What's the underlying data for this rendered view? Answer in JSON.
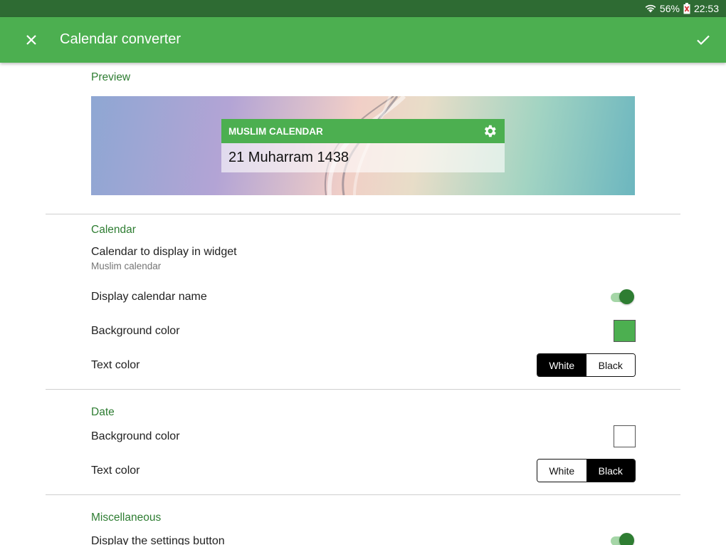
{
  "status_bar": {
    "battery": "56%",
    "time": "22:53",
    "icons": [
      "wifi-icon",
      "battery-icon"
    ]
  },
  "app_bar": {
    "title": "Calendar converter",
    "close_icon": "close-icon",
    "confirm_icon": "check-icon"
  },
  "preview": {
    "header": "Preview",
    "widget_title": "MUSLIM CALENDAR",
    "widget_date": "21 Muharram 1438",
    "gear_icon": "gear-icon"
  },
  "calendar": {
    "header": "Calendar",
    "display_label": "Calendar to display in widget",
    "display_value": "Muslim calendar",
    "name_label": "Display calendar name",
    "name_on": true,
    "bg_label": "Background color",
    "bg_color": "#4caf50",
    "text_label": "Text color",
    "text_options": [
      "White",
      "Black"
    ],
    "text_selected": "White"
  },
  "date": {
    "header": "Date",
    "bg_label": "Background color",
    "bg_color": "#ffffff",
    "text_label": "Text color",
    "text_options": [
      "White",
      "Black"
    ],
    "text_selected": "Black"
  },
  "misc": {
    "header": "Miscellaneous",
    "settings_label": "Display the settings button",
    "settings_on": true
  },
  "colors": {
    "app_bar": "#4caf50",
    "status_bar": "#2e6b33",
    "accent": "#2e7d32"
  }
}
